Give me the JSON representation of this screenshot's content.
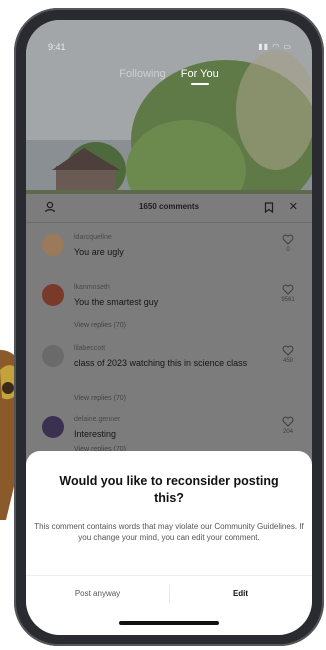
{
  "status_bar": {
    "time": "9:41",
    "icons": "▮▮ ◠ ▭"
  },
  "feed": {
    "tabs": [
      "Following",
      "For You"
    ],
    "active_tab": "For You"
  },
  "comments_panel": {
    "title": "1650 comments"
  },
  "comments": [
    {
      "username": "ldarcquellne",
      "text": "You are ugly",
      "likes": "0",
      "replies": ""
    },
    {
      "username": "lkanmnseth",
      "text": "You the smartest guy",
      "likes": "9561",
      "replies": "View replies (70)"
    },
    {
      "username": "lilabeccott",
      "text": "class of 2023 watching this in science class",
      "likes": "450",
      "replies": "View replies (70)"
    },
    {
      "username": "delaine.genner",
      "text": "Interesting",
      "likes": "204",
      "replies": "View replies (70)"
    }
  ],
  "dialog": {
    "title": "Would you like to reconsider posting this?",
    "body": "This comment contains words that may violate our Community Guidelines. If you change your mind, you can edit your comment.",
    "post_anyway_label": "Post anyway",
    "edit_label": "Edit"
  },
  "colors": {
    "sheet_background": "#7c7c7c",
    "dialog_background": "#ffffff",
    "phone_frame": "#2a2b30",
    "mascot": "#8a5a2a"
  }
}
